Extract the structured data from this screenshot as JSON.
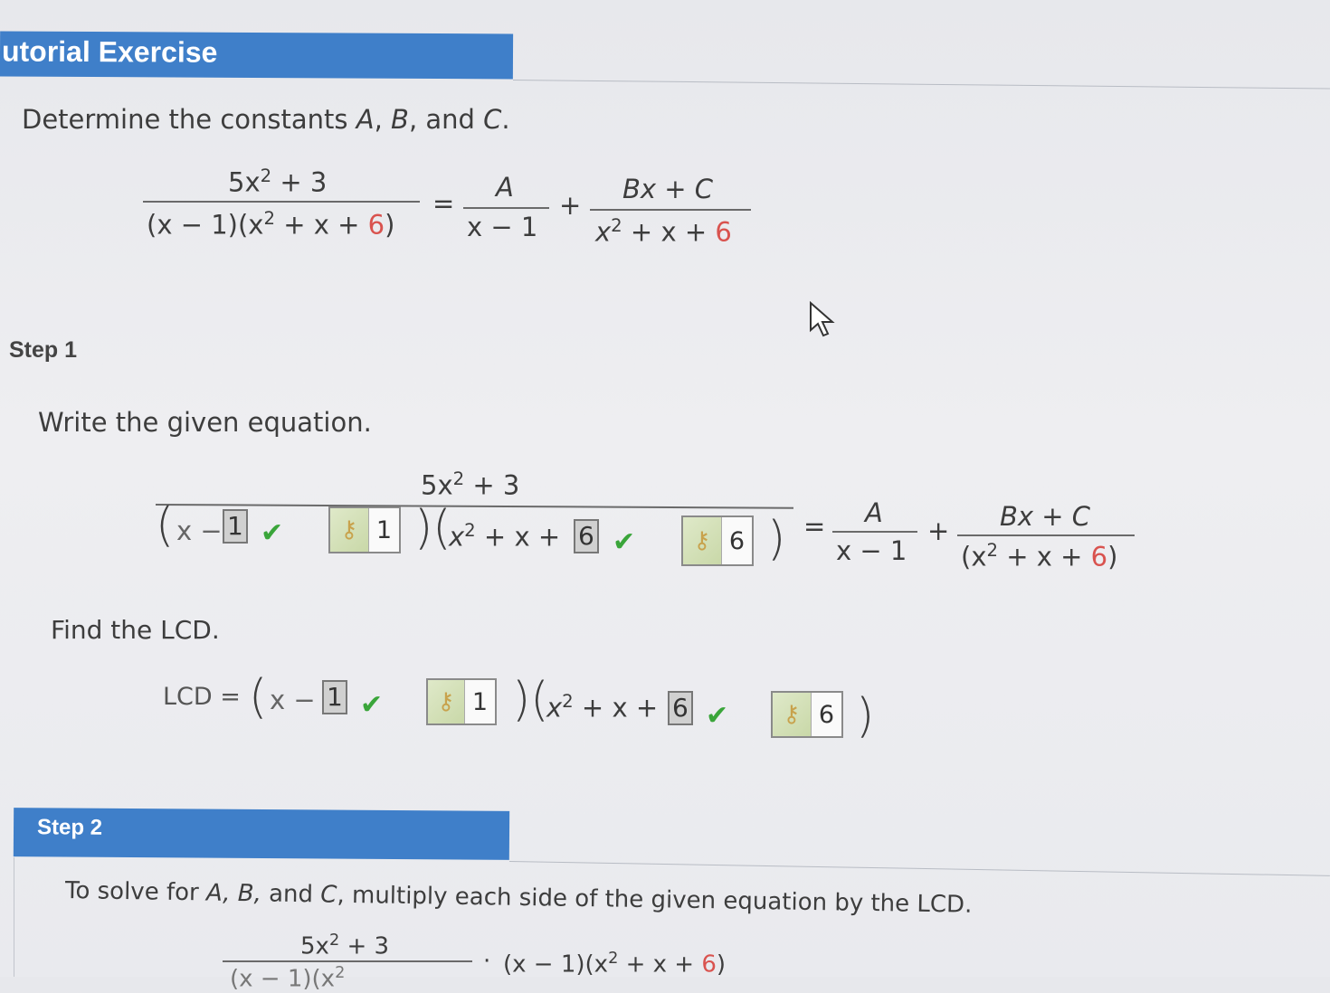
{
  "header": {
    "title": "utorial Exercise"
  },
  "problem": {
    "prompt_prefix": "Determine the constants ",
    "var_a": "A",
    "sep1": ", ",
    "var_b": "B",
    "sep2": ", and ",
    "var_c": "C",
    "prompt_end": ".",
    "lhs_num_coef": "5x",
    "lhs_num_rest": " + 3",
    "lhs_den_a": "(x − 1)(x",
    "lhs_den_b": " + x + ",
    "lhs_den_c": "6",
    "lhs_den_d": ")",
    "exp2": "2",
    "equals": "=",
    "plus": "+",
    "rhs1_num": "A",
    "rhs1_den": "x − 1",
    "rhs2_num": "Bx + C",
    "rhs2_den_a": "x",
    "rhs2_den_b": " + x + ",
    "rhs2_den_c": "6"
  },
  "step1": {
    "label": "Step 1",
    "instruction": "Write the given equation.",
    "frac_num_a": "5x",
    "frac_num_b": " + 3",
    "factor1_prefix": "x −",
    "factor1_value": "1",
    "factor1_key": "1",
    "factor2_prefix_a": "x",
    "factor2_prefix_b": " + x +",
    "factor2_value": "6",
    "factor2_key": "6",
    "rhs1_num": "A",
    "rhs1_den": "x − 1",
    "rhs2_num": "Bx + C",
    "rhs2_den_a": "(x",
    "rhs2_den_b": " + x + ",
    "rhs2_den_c": "6",
    "rhs2_den_d": ")",
    "lcd_instruction": "Find the LCD.",
    "lcd_label": "LCD =",
    "lcd_factor1_value": "1",
    "lcd_factor1_key": "1",
    "lcd_factor2_value": "6",
    "lcd_factor2_key": "6"
  },
  "step2": {
    "label": "Step 2",
    "instruction_a": "To solve for ",
    "instruction_vars": "A, B,",
    "instruction_b": " and ",
    "instruction_c": "C",
    "instruction_d": ", multiply each side of the given equation by the LCD.",
    "num_a": "5x",
    "num_b": " + 3",
    "den_partial": "(x − 1)(x",
    "times": "·",
    "lcd_expr_a": "(x − 1)(x",
    "lcd_expr_b": " + x + ",
    "lcd_expr_c": "6",
    "lcd_expr_d": ")"
  },
  "icons": {
    "check": "check-icon",
    "key": "key-icon",
    "cursor": "mouse-cursor-icon"
  },
  "colors": {
    "banner": "#3f7fc9",
    "red_constant": "#d9534f",
    "check": "#3aa53a"
  }
}
